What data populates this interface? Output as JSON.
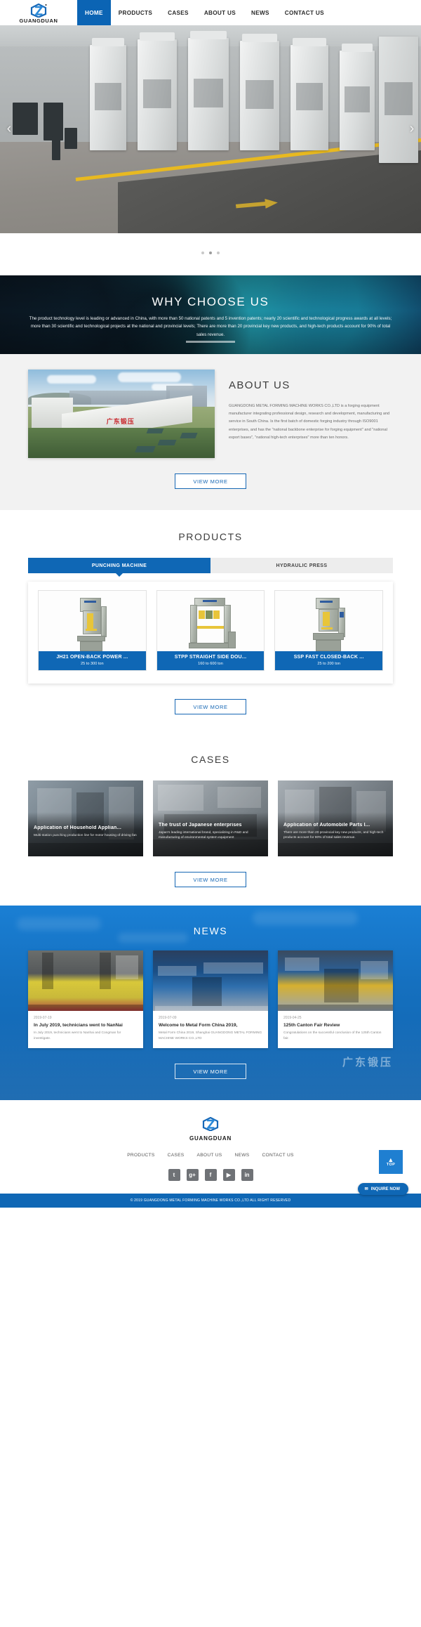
{
  "brand": {
    "name": "GUANGDUAN",
    "mark": "logo-hexagon-icon"
  },
  "nav": {
    "items": [
      {
        "label": "HOME",
        "active": true
      },
      {
        "label": "PRODUCTS",
        "active": false
      },
      {
        "label": "CASES",
        "active": false
      },
      {
        "label": "ABOUT US",
        "active": false
      },
      {
        "label": "NEWS",
        "active": false
      },
      {
        "label": "CONTACT US",
        "active": false
      }
    ]
  },
  "hero": {
    "prev_icon": "chevron-left-icon",
    "next_icon": "chevron-right-icon",
    "dots": 3,
    "active_dot": 1
  },
  "why": {
    "title": "WHY CHOOSE US",
    "text": "The product technology level is leading or advanced in China, with more than 50 national patents and 5 invention patents; nearly 20 scientific and technological progress awards at all levels; more than 30 scientific and technological projects at the national and provincial levels; There are more than 20 provincial key new products, and high-tech products account for 90% of total sales revenue."
  },
  "about": {
    "title": "ABOUT US",
    "text": "GUANGDONG METAL FORMING MACHINE WORKS CO.,LTD is a forging equipment manufacturer integrating professional design, research and development, manufacturing and service in South China. Is the first batch of domestic forging industry through ISO9001 enterprises, and has the \"national backbone enterprise for forging equipment\" and \"national export bases\", \"national high-tech enterprises\" more than ten honors.",
    "button": "VIEW MORE",
    "photo_sign": "广东锻压"
  },
  "products": {
    "title": "PRODUCTS",
    "tabs": [
      {
        "label": "PUNCHING MACHINE",
        "active": true
      },
      {
        "label": "HYDRAULIC PRESS",
        "active": false
      }
    ],
    "items": [
      {
        "name": "JH21 OPEN-BACK POWER ...",
        "spec": "25 to 300 ton"
      },
      {
        "name": "STPP STRAIGHT SIDE DOU...",
        "spec": "160 to 600 ton"
      },
      {
        "name": "SSP FAST CLOSED-BACK ...",
        "spec": "25 to 200 ton"
      }
    ],
    "button": "VIEW MORE"
  },
  "cases": {
    "title": "CASES",
    "items": [
      {
        "title": "Application of Household Applian...",
        "desc": "Multi-station punching production line for motor housing of driving fan"
      },
      {
        "title": "The trust of Japanese enterprises",
        "desc": "Japan's leading international brand, specializing in R&D and manufacturing of environmental system equipment"
      },
      {
        "title": "Application of Automobile Parts I...",
        "desc": "There are more than 20 provincial key new products, and high-tech products account for 90% of total sales revenue."
      }
    ],
    "button": "VIEW MORE"
  },
  "news": {
    "title": "NEWS",
    "items": [
      {
        "date": "2019-07-19",
        "head": "In July 2019, technicians went to NanNai",
        "desc": "In July 2019, technicians went to Nanhai and Congman for investigate."
      },
      {
        "date": "2019-07-09",
        "head": "Welcome to Metal Form China 2019,",
        "desc": "Metal Form China 2019, Shanghai GUANGDONG METAL FORMING MACHINE WORKS CO.,LTD"
      },
      {
        "date": "2019-04-25",
        "head": "125th Canton Fair Review",
        "desc": "Congratulations on the successful conclusion of the 125th Canton fair."
      }
    ],
    "button": "VIEW MORE",
    "watermark": "广东锻压"
  },
  "footer": {
    "nav": [
      "PRODUCTS",
      "CASES",
      "ABOUT US",
      "NEWS",
      "CONTACT US"
    ],
    "social": [
      {
        "icon": "twitter-icon",
        "glyph": "t"
      },
      {
        "icon": "google-plus-icon",
        "glyph": "g+"
      },
      {
        "icon": "facebook-icon",
        "glyph": "f"
      },
      {
        "icon": "youtube-icon",
        "glyph": "▶"
      },
      {
        "icon": "linkedin-icon",
        "glyph": "in"
      }
    ],
    "copyright": "© 2019 GUANGDONG METAL FORMING MACHINE WORKS CO.,LTD ALL RIGHT RESERVED",
    "to_top_label": "TOP",
    "inquire_label": "INQUIRE NOW"
  }
}
